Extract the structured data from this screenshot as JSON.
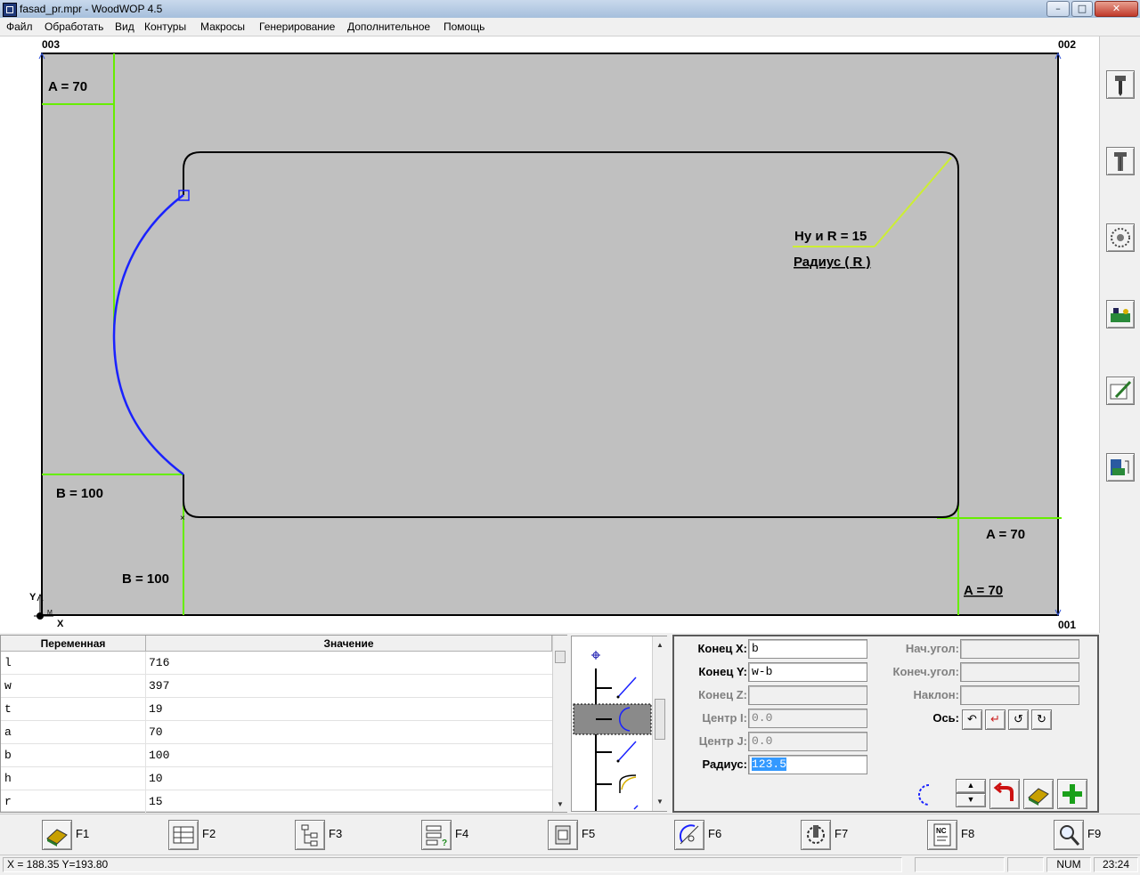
{
  "window": {
    "title": "fasad_pr.mpr - WoodWOP 4.5",
    "buttons": [
      "–",
      "□",
      "✕"
    ]
  },
  "menu": [
    "Файл",
    "Обработать",
    "Вид",
    "Контуры",
    "Макросы",
    "Генерирование",
    "Дополнительное",
    "Помощь"
  ],
  "canvas": {
    "corner_labels": {
      "top_left": "003",
      "top_right": "002",
      "bottom_right": "001"
    },
    "axis_labels": {
      "y": "Y",
      "x": "X",
      "marker": "M"
    },
    "dimensions": {
      "a_top_left": "A = 70",
      "b_left": "B = 100",
      "b_bottom": "B = 100",
      "a_right": "A = 70",
      "a_bottom_right": "A = 70",
      "radius_value": "Ну и R = 15",
      "radius_caption": "Радиус ( R )"
    },
    "colors": {
      "background": "#c0c0c0",
      "contour": "#000000",
      "dimension": "#66ee00",
      "active_arc": "#1a22ff",
      "radius_leader": "#ccee33"
    }
  },
  "right_toolbar": {
    "icons": [
      "drill-vertical-icon",
      "drill-horizontal-icon",
      "saw-blade-icon",
      "machine-unit-icon",
      "edit-pen-icon",
      "database-icon"
    ]
  },
  "variables": {
    "headers": {
      "name": "Переменная",
      "value": "Значение"
    },
    "rows": [
      {
        "name": "l",
        "value": "716"
      },
      {
        "name": "w",
        "value": "397"
      },
      {
        "name": "t",
        "value": "19"
      },
      {
        "name": "a",
        "value": "70"
      },
      {
        "name": "b",
        "value": "100"
      },
      {
        "name": "h",
        "value": "10"
      },
      {
        "name": "r",
        "value": "15"
      }
    ]
  },
  "contour_tree": {
    "items": [
      "start-point",
      "line",
      "arc-selected",
      "line",
      "arc-corner",
      "line"
    ],
    "selected": 2
  },
  "properties": {
    "end_x": {
      "label": "Конец X:",
      "value": "b"
    },
    "end_y": {
      "label": "Конец Y:",
      "value": "w-b"
    },
    "end_z": {
      "label": "Конец Z:",
      "value": ""
    },
    "center_i": {
      "label": "Центр I:",
      "value": "0.0"
    },
    "center_j": {
      "label": "Центр J:",
      "value": "0.0"
    },
    "radius": {
      "label": "Радиус:",
      "value": "123.5"
    },
    "start_angle": {
      "label": "Нач.угол:",
      "value": ""
    },
    "end_angle": {
      "label": "Конеч.угол:",
      "value": ""
    },
    "slope": {
      "label": "Наклон:",
      "value": ""
    },
    "axis": {
      "label": "Ось:"
    }
  },
  "fkeys": [
    "F1",
    "F2",
    "F3",
    "F4",
    "F5",
    "F6",
    "F7",
    "F8",
    "F9"
  ],
  "status": {
    "coords": "X = 188.35    Y=193.80",
    "num": "NUM",
    "time": "23:24"
  }
}
